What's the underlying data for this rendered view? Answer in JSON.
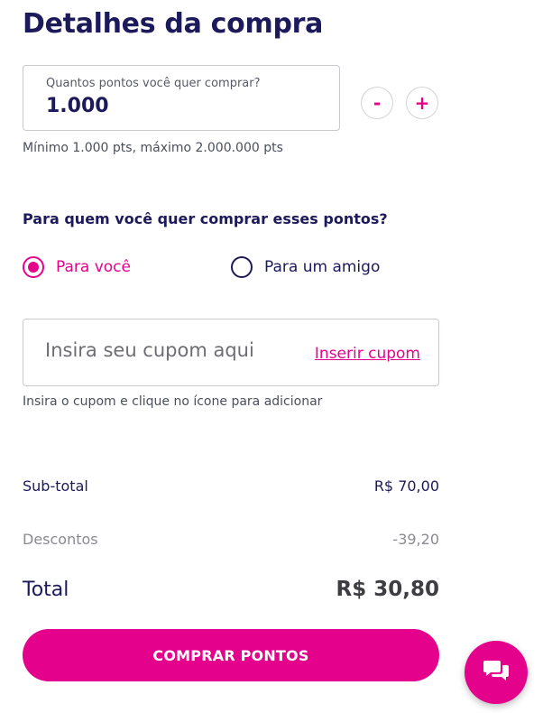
{
  "header": {
    "title": "Detalhes da compra"
  },
  "quantity": {
    "label": "Quantos pontos você quer comprar?",
    "value": "1.000",
    "decrement_label": "-",
    "increment_label": "+",
    "hint": "Mínimo 1.000 pts, máximo 2.000.000 pts"
  },
  "recipient": {
    "question": "Para quem você quer comprar esses pontos?",
    "options": [
      {
        "label": "Para você",
        "selected": true
      },
      {
        "label": "Para um amigo",
        "selected": false
      }
    ]
  },
  "coupon": {
    "placeholder": "Insira seu cupom aqui",
    "link_label": "Inserir cupom",
    "hint": "Insira o cupom e clique no ícone para adicionar"
  },
  "summary": {
    "subtotal_label": "Sub-total",
    "subtotal_value": "R$ 70,00",
    "discount_label": "Descontos",
    "discount_value": "-39,20",
    "total_label": "Total",
    "total_value": "R$ 30,80"
  },
  "actions": {
    "buy_label": "COMPRAR PONTOS"
  },
  "chat": {
    "icon": "chat-icon"
  },
  "colors": {
    "accent": "#e4028c",
    "text_primary": "#1c1a5a"
  }
}
